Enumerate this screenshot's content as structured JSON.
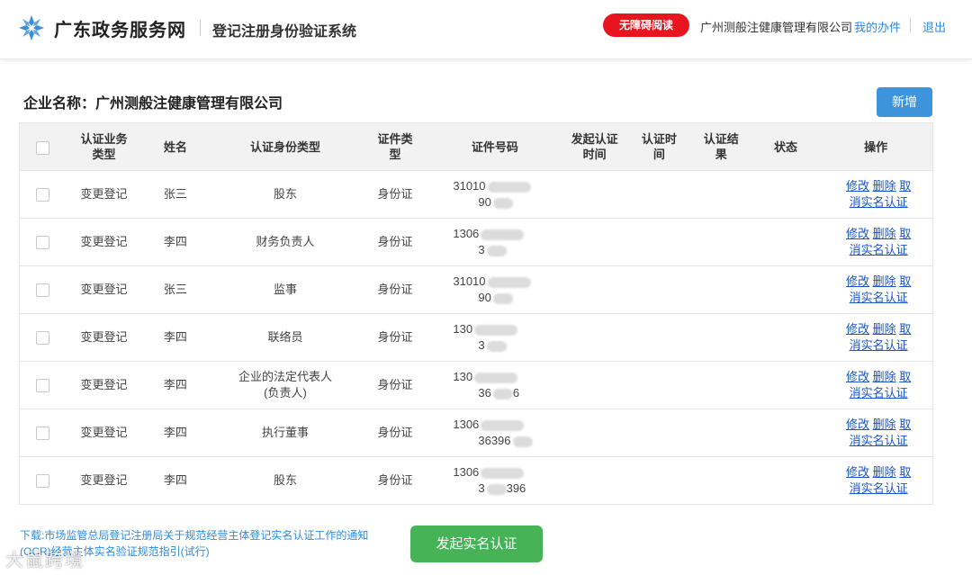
{
  "header": {
    "site_name": "广东政务服务网",
    "system_name": "登记注册身份验证系统",
    "accessibility_label": "无障碍阅读",
    "company_name": "广州测般注健康管理有限公司",
    "my_tasks": "我的办件",
    "logout": "退出"
  },
  "main": {
    "company_label": "企业名称：广州测般注健康管理有限公司",
    "add_button": "新增"
  },
  "table": {
    "headers": {
      "business_type": "认证业务\n类型",
      "name": "姓名",
      "identity_type": "认证身份类型",
      "id_type": "证件类\n型",
      "id_number": "证件号码",
      "start_time": "发起认证\n时间",
      "auth_time": "认证时\n间",
      "result": "认证结\n果",
      "status": "状态",
      "actions": "操作"
    },
    "ops": {
      "edit": "修改",
      "delete": "删除",
      "cancel": "取消实名认证"
    },
    "rows": [
      {
        "business_type": "变更登记",
        "name": "张三",
        "identity_type": "股东",
        "id_type": "身份证",
        "id_line1": "31010",
        "id_line2": "90",
        "id_line2_tail": ""
      },
      {
        "business_type": "变更登记",
        "name": "李四",
        "identity_type": "财务负责人",
        "id_type": "身份证",
        "id_line1": "1306",
        "id_line2": "3",
        "id_line2_tail": ""
      },
      {
        "business_type": "变更登记",
        "name": "张三",
        "identity_type": "监事",
        "id_type": "身份证",
        "id_line1": "31010",
        "id_line2": "90",
        "id_line2_tail": ""
      },
      {
        "business_type": "变更登记",
        "name": "李四",
        "identity_type": "联络员",
        "id_type": "身份证",
        "id_line1": "130",
        "id_line2": "3",
        "id_line2_tail": ""
      },
      {
        "business_type": "变更登记",
        "name": "李四",
        "identity_type": "企业的法定代表人\n(负责人)",
        "id_type": "身份证",
        "id_line1": "130",
        "id_line2": "36",
        "id_line2_tail": "6"
      },
      {
        "business_type": "变更登记",
        "name": "李四",
        "identity_type": "执行董事",
        "id_type": "身份证",
        "id_line1": "1306",
        "id_line2": "36396",
        "id_line2_tail": ""
      },
      {
        "business_type": "变更登记",
        "name": "李四",
        "identity_type": "股东",
        "id_type": "身份证",
        "id_line1": "1306",
        "id_line2": "3",
        "id_line2_tail": "396"
      }
    ]
  },
  "footer": {
    "download_text": "下载:市场监管总局登记注册局关于规范经营主体登记实名认证工作的通知(OCR)经营主体实名验证规范指引(试行)",
    "submit_button": "发起实名认证",
    "watermark": "大鼠跨境"
  },
  "colors": {
    "accent": "#3d94da",
    "danger": "#e8141f",
    "success": "#46b356",
    "link": "#1a56c9"
  }
}
